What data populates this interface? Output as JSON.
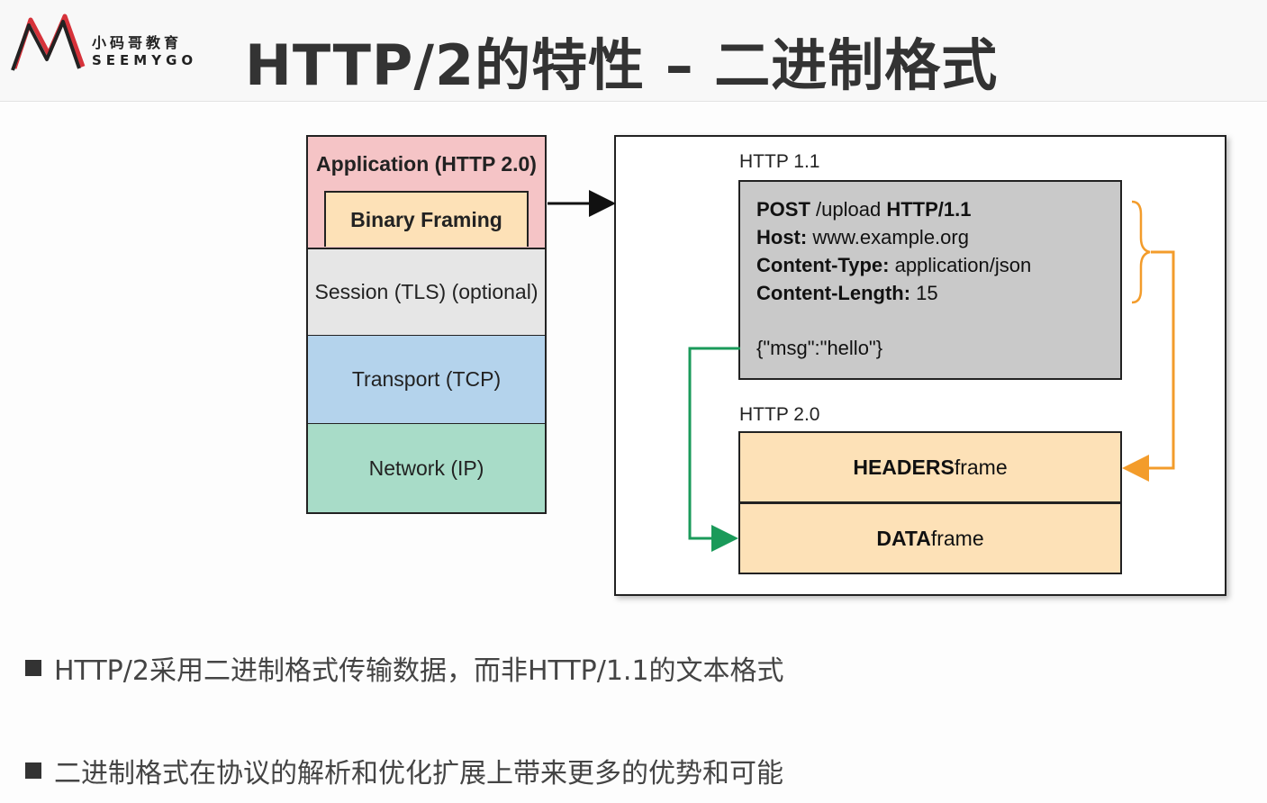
{
  "header": {
    "logo_cn": "小码哥教育",
    "logo_en": "SEEMYGO",
    "title": "HTTP/2的特性 – 二进制格式"
  },
  "stack": {
    "application": "Application (HTTP 2.0)",
    "binary_framing": "Binary Framing",
    "session": "Session (TLS) (optional)",
    "transport": "Transport (TCP)",
    "network": "Network (IP)"
  },
  "panel": {
    "http11_label": "HTTP 1.1",
    "http20_label": "HTTP 2.0",
    "request": {
      "line1_bold_a": "POST",
      "line1_normal": " /upload ",
      "line1_bold_b": "HTTP/1.1",
      "host_key": "Host:",
      "host_val": " www.example.org",
      "ctype_key": "Content-Type:",
      "ctype_val": " application/json",
      "clen_key": "Content-Length:",
      "clen_val": " 15",
      "body": "{\"msg\":\"hello\"}"
    },
    "headers_frame_bold": "HEADERS",
    "headers_frame_rest": " frame",
    "data_frame_bold": "DATA",
    "data_frame_rest": " frame"
  },
  "bullets": [
    "HTTP/2采用二进制格式传输数据，而非HTTP/1.1的文本格式",
    "二进制格式在协议的解析和优化扩展上带来更多的优势和可能"
  ],
  "colors": {
    "application": "#f5c4c6",
    "framing": "#fde1b7",
    "session": "#e6e6e6",
    "transport": "#b4d3ec",
    "network": "#a8dcc8",
    "orange_arrow": "#f39c2b",
    "green_arrow": "#1a9a5a",
    "logo_red": "#d6323a"
  }
}
